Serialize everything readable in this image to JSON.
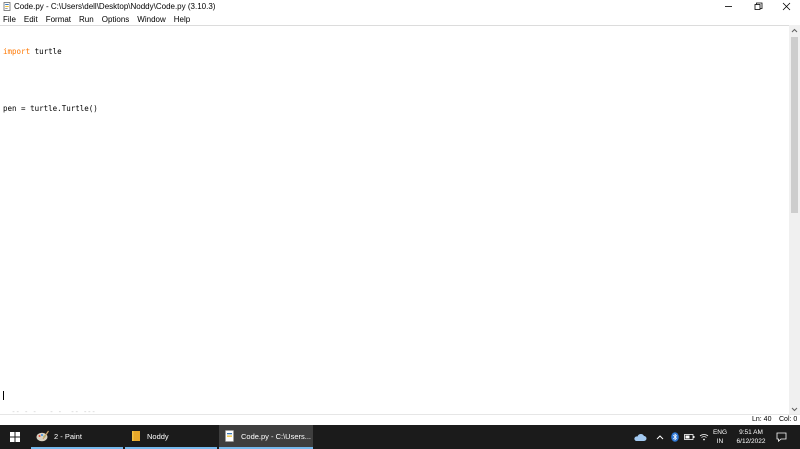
{
  "window": {
    "title": "Code.py - C:\\Users\\dell\\Desktop\\Noddy\\Code.py (3.10.3)"
  },
  "menu": [
    "File",
    "Edit",
    "Format",
    "Run",
    "Options",
    "Window",
    "Help"
  ],
  "editor": {
    "lines": [
      {
        "keyword": "import",
        "rest": " turtle"
      },
      {
        "keyword": "",
        "rest": ""
      },
      {
        "keyword": "",
        "rest": "pen = turtle.Turtle()"
      }
    ],
    "faded_text": "  -- - -   - -  -- ---"
  },
  "status": {
    "line": "Ln: 40",
    "col": "Col: 0"
  },
  "taskbar": {
    "apps": [
      {
        "label": "2 - Paint",
        "icon": "paint-icon"
      },
      {
        "label": "Noddy",
        "icon": "folder-icon"
      },
      {
        "label": "Code.py - C:\\Users...",
        "icon": "python-file-icon"
      }
    ],
    "tray": {
      "language": "ENG",
      "region": "IN",
      "time": "9:51 AM",
      "date": "6/12/2022"
    }
  },
  "colors": {
    "keyword": "#ff7700",
    "taskbar": "#1b1b1b",
    "active_indicator": "#76b9ed"
  }
}
